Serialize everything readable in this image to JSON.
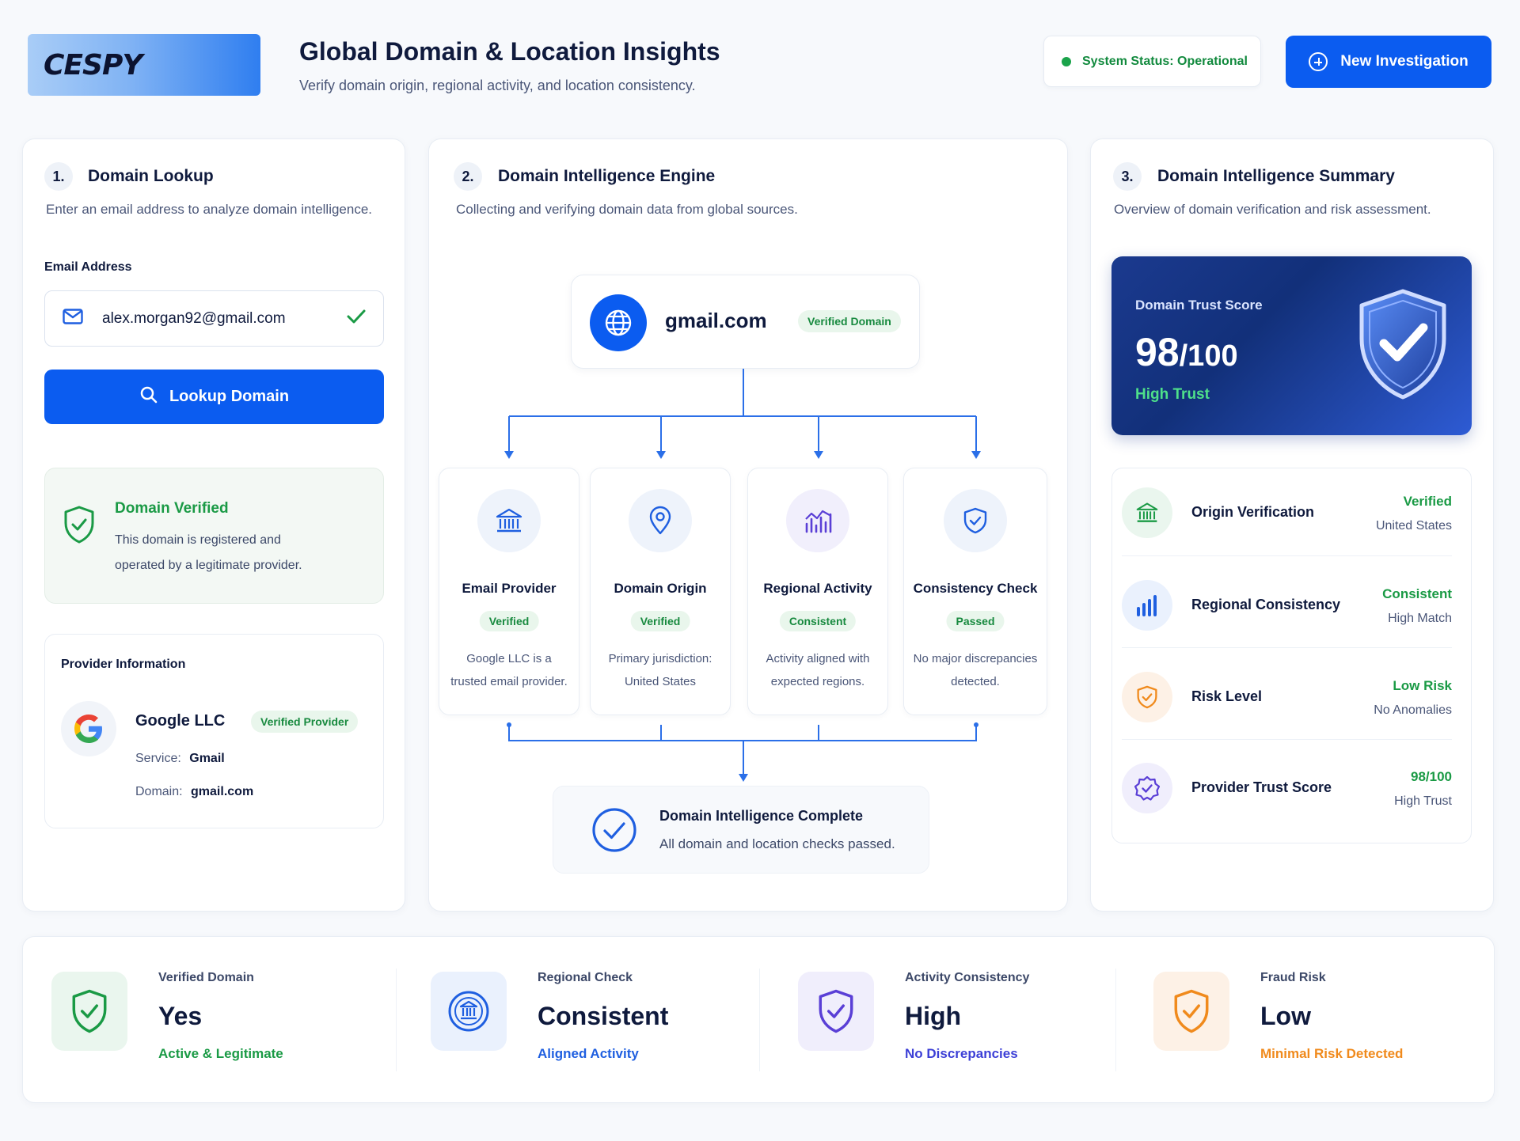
{
  "header": {
    "logo_text": "CESPY",
    "title": "Global Domain & Location Insights",
    "subtitle": "Verify domain origin, regional activity, and location consistency.",
    "status": "System Status: Operational",
    "new_investigation": "New Investigation"
  },
  "lookup": {
    "step": "1.",
    "title": "Domain Lookup",
    "desc": "Enter an email address to analyze domain intelligence.",
    "email_label": "Email Address",
    "email_value": "alex.morgan92@gmail.com",
    "button": "Lookup Domain",
    "verified_title": "Domain Verified",
    "verified_line1": "This domain is registered and",
    "verified_line2": "operated by a legitimate provider.",
    "provider_heading": "Provider Information",
    "provider_name": "Google LLC",
    "provider_badge": "Verified Provider",
    "service_label": "Service:",
    "service_value": "Gmail",
    "domain_label": "Domain:",
    "domain_value": "gmail.com"
  },
  "engine": {
    "step": "2.",
    "title": "Domain Intelligence Engine",
    "desc": "Collecting and verifying domain data from global sources.",
    "domain": "gmail.com",
    "domain_badge": "Verified Domain",
    "cards": [
      {
        "title": "Email Provider",
        "status": "Verified",
        "line1": "Google LLC is a",
        "line2": "trusted email provider."
      },
      {
        "title": "Domain Origin",
        "status": "Verified",
        "line1": "Primary jurisdiction:",
        "line2": "United States"
      },
      {
        "title": "Regional Activity",
        "status": "Consistent",
        "line1": "Activity aligned with",
        "line2": "expected regions."
      },
      {
        "title": "Consistency Check",
        "status": "Passed",
        "line1": "No major discrepancies",
        "line2": "detected."
      }
    ],
    "complete_title": "Domain Intelligence Complete",
    "complete_desc": "All domain and location checks passed."
  },
  "summary": {
    "step": "3.",
    "title": "Domain Intelligence Summary",
    "desc": "Overview of domain verification and risk assessment.",
    "trust_label": "Domain Trust Score",
    "trust_score": "98",
    "trust_max": "/100",
    "trust_level": "High Trust",
    "rows": [
      {
        "label": "Origin Verification",
        "status": "Verified",
        "sub": "United States",
        "color": "#1a9a45"
      },
      {
        "label": "Regional Consistency",
        "status": "Consistent",
        "sub": "High Match",
        "color": "#1a9a45"
      },
      {
        "label": "Risk Level",
        "status": "Low Risk",
        "sub": "No Anomalies",
        "color": "#1a9a45"
      },
      {
        "label": "Provider Trust Score",
        "status": "98/100",
        "sub": "High Trust",
        "color": "#1a9a45"
      }
    ]
  },
  "bottom": [
    {
      "label": "Verified Domain",
      "value": "Yes",
      "sub": "Active & Legitimate",
      "color": "#1a9a45"
    },
    {
      "label": "Regional Check",
      "value": "Consistent",
      "sub": "Aligned Activity",
      "color": "#1f5fe0"
    },
    {
      "label": "Activity Consistency",
      "value": "High",
      "sub": "No Discrepancies",
      "color": "#3c3fd6"
    },
    {
      "label": "Fraud Risk",
      "value": "Low",
      "sub": "Minimal Risk Detected",
      "color": "#f08a1c"
    }
  ]
}
